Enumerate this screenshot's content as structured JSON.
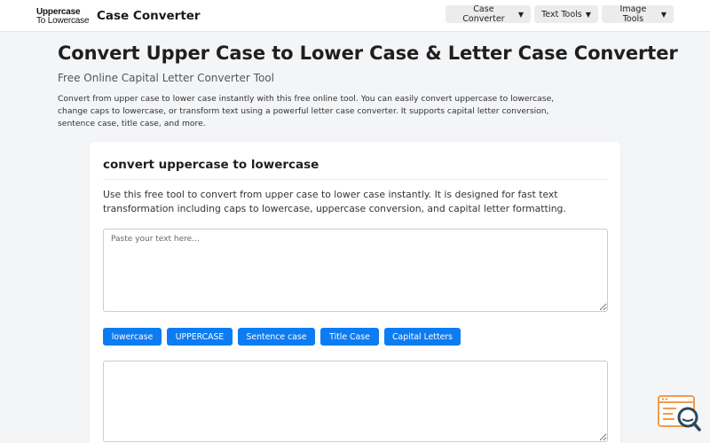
{
  "header": {
    "logo_line1": "Uppercase",
    "logo_line2": "To Lowercase",
    "brand": "Case Converter",
    "nav": [
      {
        "label": "Case Converter",
        "caret": "▼"
      },
      {
        "label": "Text Tools",
        "caret": "▼"
      },
      {
        "label": "Image Tools",
        "caret": "▼"
      }
    ]
  },
  "hero": {
    "title": "Convert Upper Case to Lower Case & Letter Case Converter",
    "subtitle": "Free Online Capital Letter Converter Tool",
    "intro": "Convert from upper case to lower case instantly with this free online tool. You can easily convert uppercase to lowercase, change caps to lowercase, or transform text using a powerful letter case converter. It supports capital letter conversion, sentence case, title case, and more."
  },
  "tool": {
    "title": "convert uppercase to lowercase",
    "description": "Use this free tool to convert from upper case to lower case instantly. It is designed for fast text transformation including caps to lowercase, uppercase conversion, and capital letter formatting.",
    "input_placeholder": "Paste your text here...",
    "input_value": "",
    "output_value": "",
    "buttons": [
      "lowercase",
      "UPPERCASE",
      "Sentence case",
      "Title Case",
      "Capital Letters"
    ]
  },
  "widget": {
    "icon": "search-review-icon",
    "colors": {
      "accent": "#f39a4a",
      "lens": "#2a4a5a"
    }
  },
  "colors": {
    "primary": "#0d7cf2",
    "background": "#f4f5f7",
    "nav_button": "#ececec"
  }
}
